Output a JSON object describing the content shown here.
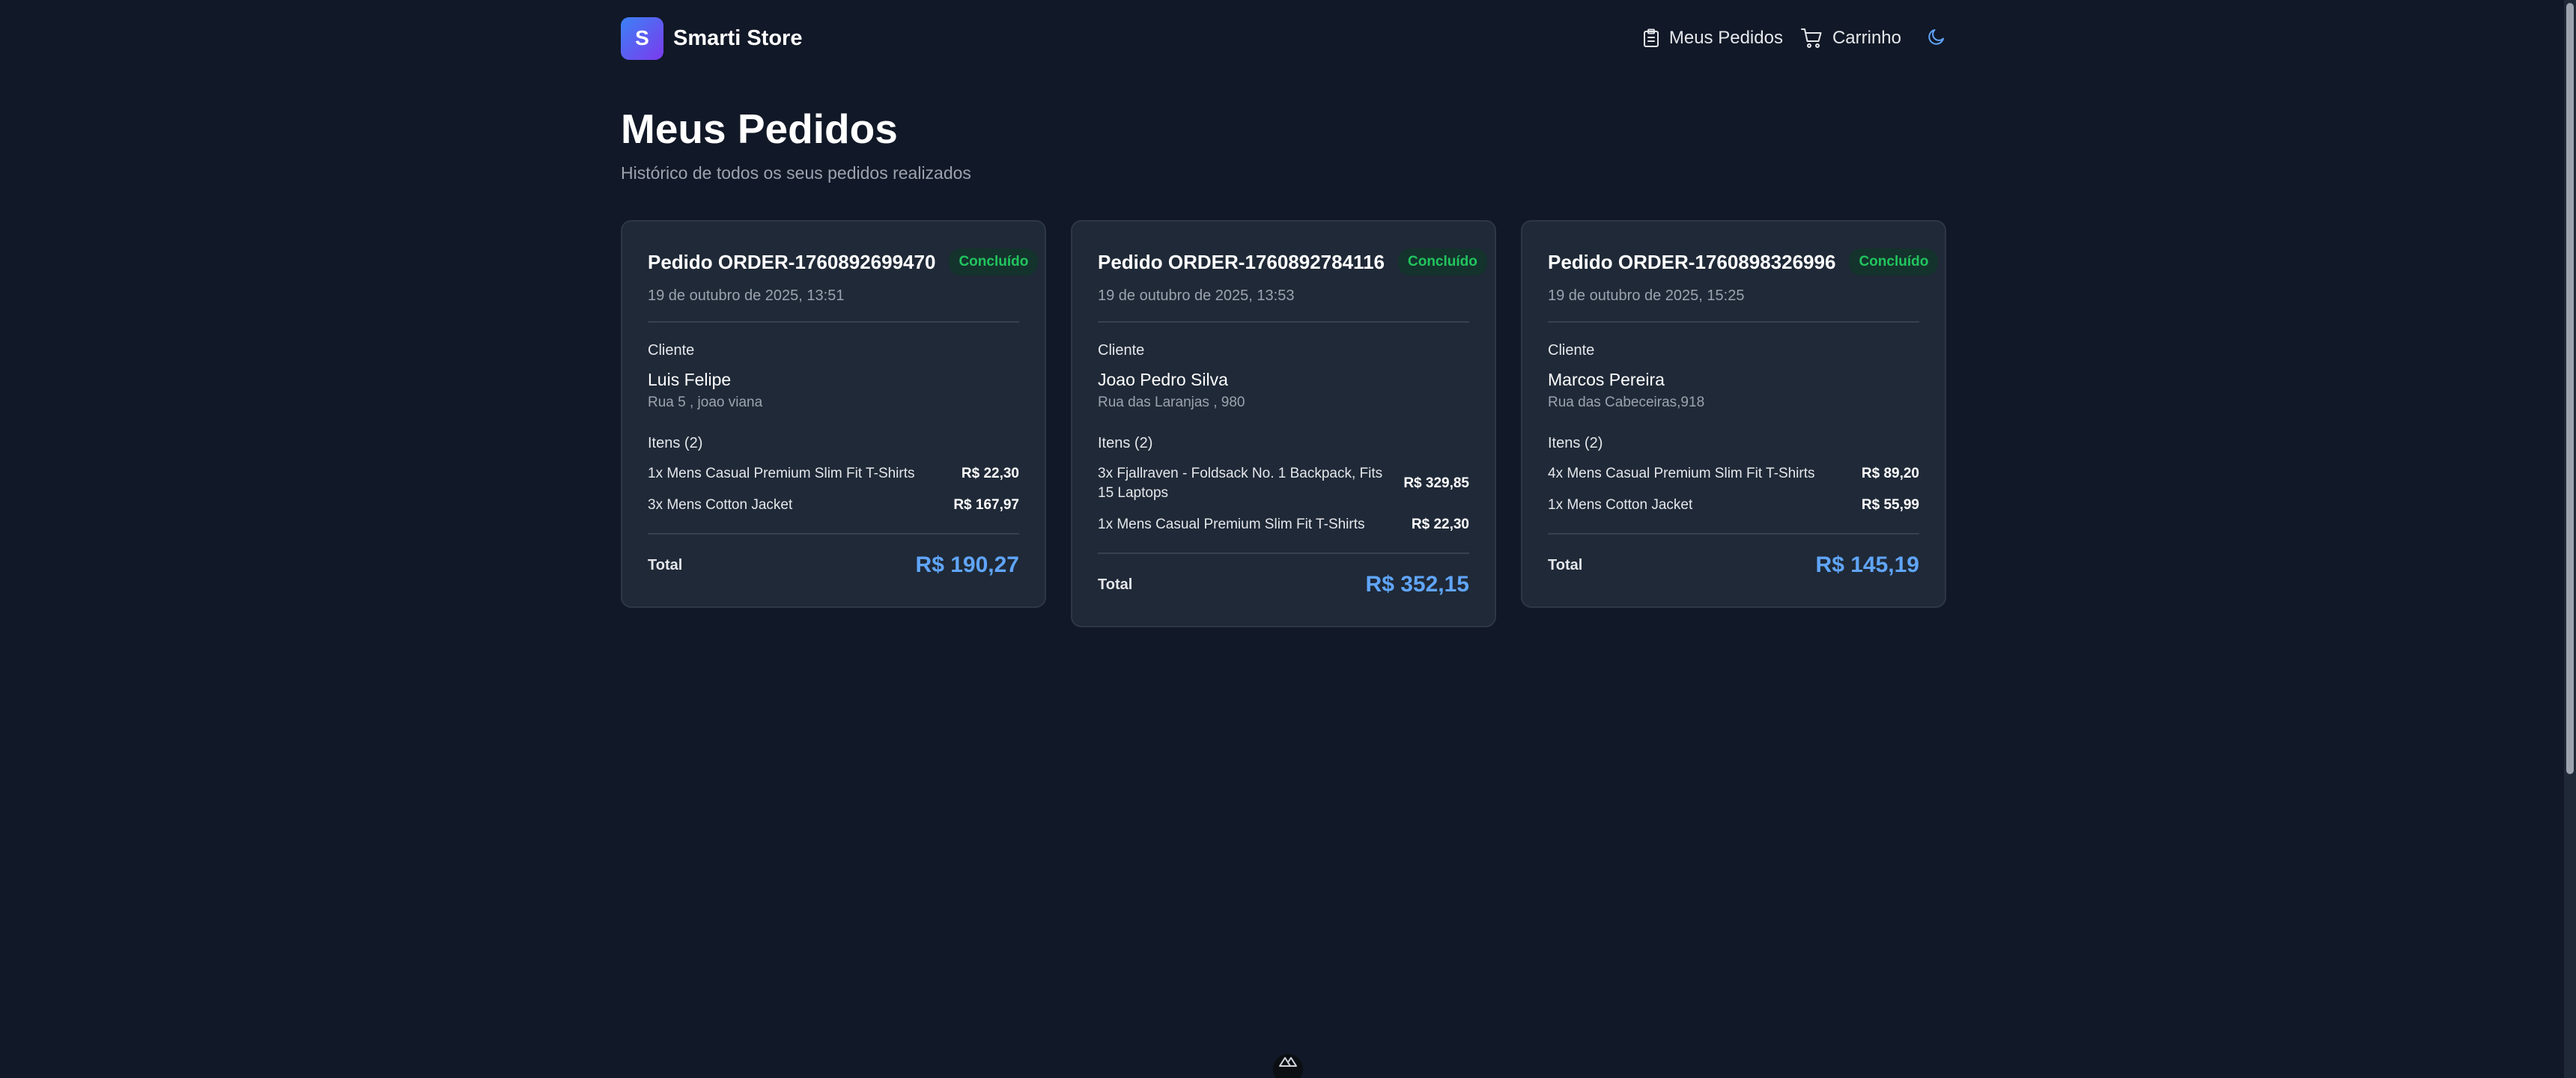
{
  "header": {
    "logo_letter": "S",
    "brand": "Smarti Store",
    "nav": {
      "orders_label": "Meus Pedidos",
      "orders_icon": "clipboard-icon",
      "cart_label": "Carrinho",
      "cart_icon": "cart-icon",
      "theme_icon": "moon-icon"
    }
  },
  "page": {
    "title": "Meus Pedidos",
    "subtitle": "Histórico de todos os seus pedidos realizados"
  },
  "labels": {
    "client": "Cliente",
    "total": "Total"
  },
  "orders": [
    {
      "id": "Pedido ORDER-1760892699470",
      "status": "Concluído",
      "date": "19 de outubro de 2025, 13:51",
      "client_name": "Luis Felipe",
      "client_address": "Rua 5 , joao viana",
      "items_label": "Itens (2)",
      "items": [
        {
          "name": "1x Mens Casual Premium Slim Fit T-Shirts",
          "price": "R$ 22,30"
        },
        {
          "name": "3x Mens Cotton Jacket",
          "price": "R$ 167,97"
        }
      ],
      "total": "R$ 190,27"
    },
    {
      "id": "Pedido ORDER-1760892784116",
      "status": "Concluído",
      "date": "19 de outubro de 2025, 13:53",
      "client_name": "Joao Pedro Silva",
      "client_address": "Rua das Laranjas , 980",
      "items_label": "Itens (2)",
      "items": [
        {
          "name": "3x Fjallraven - Foldsack No. 1 Backpack, Fits 15 Laptops",
          "price": "R$ 329,85"
        },
        {
          "name": "1x Mens Casual Premium Slim Fit T-Shirts",
          "price": "R$ 22,30"
        }
      ],
      "total": "R$ 352,15"
    },
    {
      "id": "Pedido ORDER-1760898326996",
      "status": "Concluído",
      "date": "19 de outubro de 2025, 15:25",
      "client_name": "Marcos Pereira",
      "client_address": "Rua das Cabeceiras,918",
      "items_label": "Itens (2)",
      "items": [
        {
          "name": "4x Mens Casual Premium Slim Fit T-Shirts",
          "price": "R$ 89,20"
        },
        {
          "name": "1x Mens Cotton Jacket",
          "price": "R$ 55,99"
        }
      ],
      "total": "R$ 145,19"
    }
  ],
  "colors": {
    "background": "#111827",
    "card": "#1f2937",
    "accent": "#60a5fa",
    "status_green": "#22c55e"
  }
}
